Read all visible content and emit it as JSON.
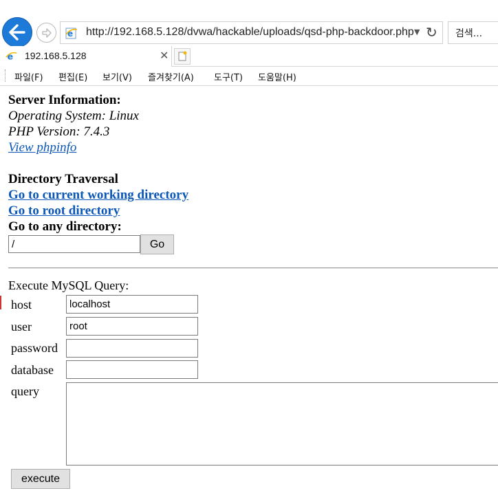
{
  "browser": {
    "url": "http://192.168.5.128/dvwa/hackable/uploads/qsd-php-backdoor.php",
    "search_placeholder": "검색...",
    "tab_title": "192.168.5.128",
    "menu": [
      "파일(F)",
      "편집(E)",
      "보기(V)",
      "즐겨찾기(A)",
      "도구(T)",
      "도움말(H)"
    ],
    "accent_color": "#1e7ad9"
  },
  "server_info": {
    "heading": "Server Information:",
    "os": "Operating System: Linux",
    "php": "PHP Version: 7.4.3",
    "phpinfo_link": "View phpinfo"
  },
  "directory": {
    "heading": "Directory Traversal",
    "cwd_link": "Go to current working directory",
    "root_link": "Go to root directory",
    "any_label": "Go to any directory:",
    "path_value": "/",
    "go_label": "Go"
  },
  "mysql": {
    "heading": "Execute MySQL Query:",
    "host_label": "host",
    "host_value": "localhost",
    "user_label": "user",
    "user_value": "root",
    "password_label": "password",
    "password_value": "",
    "database_label": "database",
    "database_value": "",
    "query_label": "query",
    "query_value": "",
    "execute_label": "execute"
  }
}
